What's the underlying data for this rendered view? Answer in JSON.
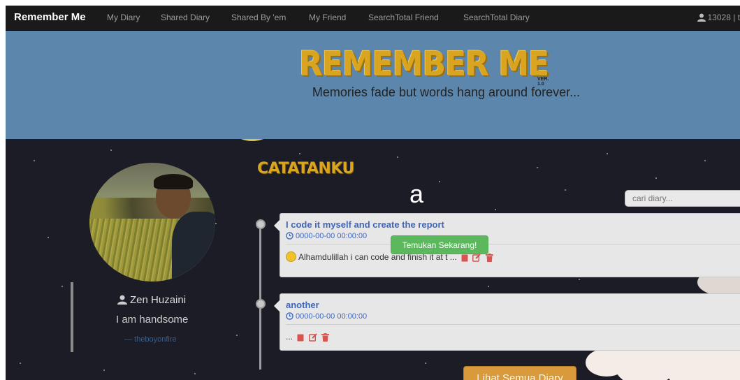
{
  "navbar": {
    "brand": "Remember Me",
    "links": [
      "My Diary",
      "Shared Diary",
      "Shared By 'em",
      "My Friend",
      "SearchTotal Friend",
      "SearchTotal Diary"
    ],
    "user_label": "13028 | t",
    "user_icon": "user-icon"
  },
  "banner": {
    "logo_text": "REMEMBER ME",
    "logo_version": "VER. 1.0",
    "tagline": "Memories fade but words hang around forever..."
  },
  "profile": {
    "name": "Zen Huzaini",
    "bio": "I am handsome",
    "handle": "— theboyonfire"
  },
  "main": {
    "section_title": "CATATANKU",
    "big_char": "a",
    "search_placeholder": "cari diary...",
    "toast": "Temukan Sekarang!",
    "view_all_button": "Lihat Semua Diary"
  },
  "diaries": [
    {
      "title": "I code it myself and create the report",
      "date": "0000-00-00 00:00:00",
      "excerpt": "Alhamdulillah i can code and finish it at t ...",
      "has_smiley": true
    },
    {
      "title": "another",
      "date": "0000-00-00 00:00:00",
      "excerpt": "...",
      "has_smiley": false
    }
  ],
  "colors": {
    "brand_gold": "#d9a521",
    "banner_blue": "#5d86ac",
    "link_blue": "#4066b8",
    "action_red": "#d9534f",
    "toast_green": "#5cb85c",
    "button_orange": "#d99a3b"
  }
}
